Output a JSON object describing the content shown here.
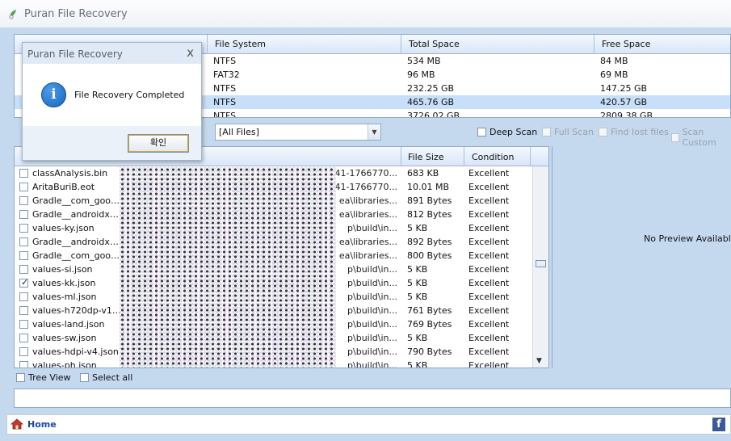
{
  "window": {
    "title": "Puran File Recovery",
    "icon": "app-leaf-icon"
  },
  "drives": {
    "columns": [
      "File System",
      "Total Space",
      "Free Space"
    ],
    "rows": [
      {
        "fs": "NTFS",
        "total": "534 MB",
        "free": "84 MB"
      },
      {
        "fs": "FAT32",
        "total": "96 MB",
        "free": "69 MB"
      },
      {
        "fs": "NTFS",
        "total": "232.25 GB",
        "free": "147.25 GB"
      },
      {
        "fs": "NTFS",
        "total": "465.76 GB",
        "free": "420.57 GB",
        "selected": true
      },
      {
        "fs": "NTFS",
        "total": "3726.02 GB",
        "free": "2809.38 GB"
      }
    ]
  },
  "toolbar": {
    "filter_value": "[All Files]",
    "deep_scan": "Deep Scan",
    "full_scan": "Full Scan",
    "find_lost": "Find lost files",
    "scan_custom": "Scan Custom"
  },
  "files": {
    "columns": {
      "size": "File Size",
      "condition": "Condition"
    },
    "rows": [
      {
        "name": "classAnalysis.bin",
        "path": "41-1766770...",
        "size": "683 KB",
        "cond": "Excellent",
        "checked": false
      },
      {
        "name": "AritaBuriB.eot",
        "path": "41-1766770...",
        "size": "10.01 MB",
        "cond": "Excellent",
        "checked": false
      },
      {
        "name": "Gradle__com_googl...",
        "path": "ea\\libraries...",
        "size": "891 Bytes",
        "cond": "Excellent",
        "checked": false
      },
      {
        "name": "Gradle__androidx_...",
        "path": "ea\\libraries...",
        "size": "812 Bytes",
        "cond": "Excellent",
        "checked": false
      },
      {
        "name": "values-ky.json",
        "path": "p\\build\\in...",
        "size": "5 KB",
        "cond": "Excellent",
        "checked": false
      },
      {
        "name": "Gradle__androidx_...",
        "path": "ea\\libraries...",
        "size": "892 Bytes",
        "cond": "Excellent",
        "checked": false
      },
      {
        "name": "Gradle__com_googl...",
        "path": "ea\\libraries...",
        "size": "800 Bytes",
        "cond": "Excellent",
        "checked": false
      },
      {
        "name": "values-si.json",
        "path": "p\\build\\in...",
        "size": "5 KB",
        "cond": "Excellent",
        "checked": false
      },
      {
        "name": "values-kk.json",
        "path": "p\\build\\in...",
        "size": "5 KB",
        "cond": "Excellent",
        "checked": true
      },
      {
        "name": "values-ml.json",
        "path": "p\\build\\in...",
        "size": "5 KB",
        "cond": "Excellent",
        "checked": false
      },
      {
        "name": "values-h720dp-v13...",
        "path": "p\\build\\in...",
        "size": "761 Bytes",
        "cond": "Excellent",
        "checked": false
      },
      {
        "name": "values-land.json",
        "path": "p\\build\\in...",
        "size": "769 Bytes",
        "cond": "Excellent",
        "checked": false
      },
      {
        "name": "values-sw.json",
        "path": "p\\build\\in...",
        "size": "5 KB",
        "cond": "Excellent",
        "checked": false
      },
      {
        "name": "values-hdpi-v4.json",
        "path": "p\\build\\in...",
        "size": "790 Bytes",
        "cond": "Excellent",
        "checked": false
      },
      {
        "name": "values-ph.json",
        "path": "p\\build\\in...",
        "size": "5 KB",
        "cond": "Excellent",
        "checked": false
      }
    ]
  },
  "preview": {
    "message": "No Preview Available"
  },
  "options": {
    "tree_view": "Tree View",
    "select_all": "Select all"
  },
  "homebar": {
    "home": "Home",
    "facebook_icon": "f"
  },
  "dialog": {
    "title": "Puran File Recovery",
    "close": "x",
    "message": "File Recovery Completed",
    "ok": "확인",
    "icon": "info-icon"
  }
}
